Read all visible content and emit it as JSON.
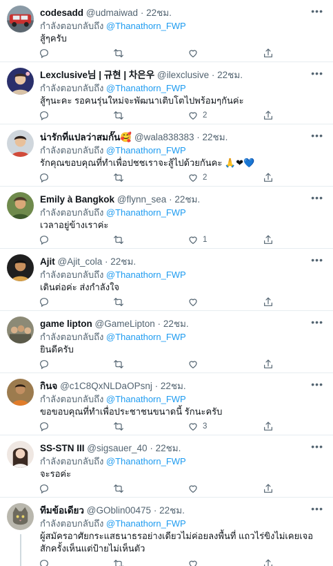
{
  "reply_prefix": "กำลังตอบกลับถึง",
  "reply_target": "@Thanathorn_FWP",
  "more_icon": "more-horizontal-icon",
  "colors": {
    "link": "#1d9bf0",
    "secondary": "#536471",
    "divider": "#e6ecf0"
  },
  "tweets": [
    {
      "name": "codesadd",
      "handle": "@udmaiwad",
      "time": "22ชม.",
      "text": "สู้ๆครับ",
      "likes": "",
      "avatar": "avatar-car"
    },
    {
      "name": "Lexclusive님 | 규현 | 차은우",
      "handle": "@ilexclusive",
      "time": "22ชม.",
      "text": "สู้ๆนะคะ รอคนรุ่นใหม่จะพัฒนาเติบโตไปพร้อมๆกันค่ะ",
      "likes": "2",
      "avatar": "avatar-person"
    },
    {
      "name": "น่ารักที่แปลว่าสมกั๊น🥰",
      "handle": "@wala838383",
      "time": "22ชม.",
      "text": "รักคุณขอบคุณที่ทำเพื่อปชชเราจะสู้ไปด้วยกันคะ 🙏❤💙",
      "likes": "2",
      "avatar": "avatar-person"
    },
    {
      "name": "Emily à Bangkok",
      "handle": "@flynn_sea",
      "time": "22ชม.",
      "text": "เวลาอยู่ข้างเราค่ะ",
      "likes": "1",
      "avatar": "avatar-person"
    },
    {
      "name": "Ajit",
      "handle": "@Ajit_cola",
      "time": "22ชม.",
      "text": "เดินต่อค่ะ ส่งกำลังใจ",
      "likes": "",
      "avatar": "avatar-person"
    },
    {
      "name": "game lipton",
      "handle": "@GameLipton",
      "time": "22ชม.",
      "text": "ยินดีครับ",
      "likes": "",
      "avatar": "avatar-group"
    },
    {
      "name": "กินจ",
      "handle": "@c1C8QxNLDaOPsnj",
      "time": "22ชม.",
      "text": "ขอขอบคุณที่ทำเพื่อประชาชนขนาดนี้ รักนะครับ",
      "likes": "3",
      "avatar": "avatar-person"
    },
    {
      "name": "SS-STN III",
      "handle": "@sigsauer_40",
      "time": "22ชม.",
      "text": "จะรอค่ะ",
      "likes": "",
      "avatar": "avatar-girl"
    },
    {
      "name": "ทีมข้อเดียว",
      "handle": "@GOblin00475",
      "time": "22ชม.",
      "text": "ผู้สมัครอาศัยกระแสธนาธรอย่างเดียวไม่ค่อยลงพื้นที่ แถวไร่ขิงไม่เคยเจอสักครั้งเห็นแต่ป้ายไม่เห็นตัว",
      "likes": "",
      "avatar": "avatar-cat"
    }
  ]
}
